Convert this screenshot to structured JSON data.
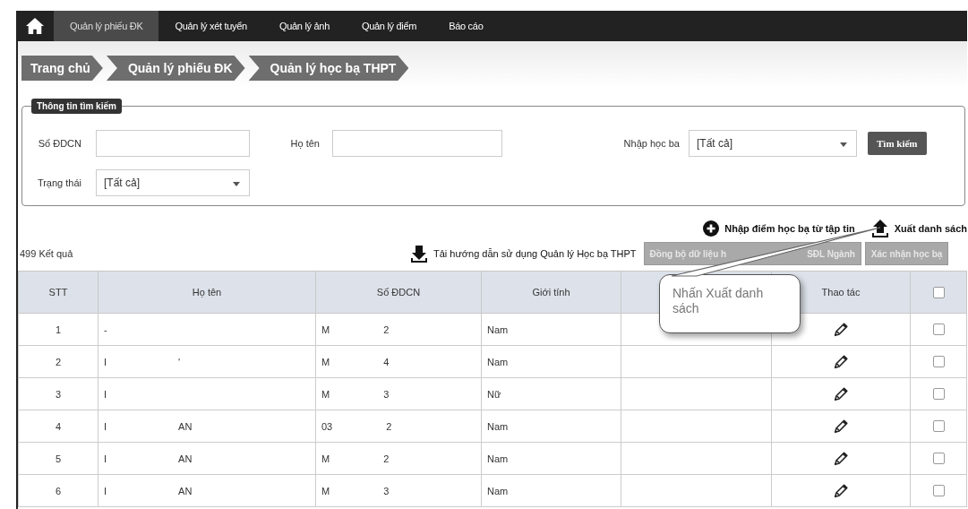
{
  "nav": {
    "tabs": [
      {
        "label": "Quản lý phiếu ĐK",
        "selected": true
      },
      {
        "label": "Quản lý xét tuyển",
        "selected": false
      },
      {
        "label": "Quản lý ảnh",
        "selected": false
      },
      {
        "label": "Quản lý điểm",
        "selected": false
      },
      {
        "label": "Báo cáo",
        "selected": false
      }
    ]
  },
  "breadcrumb": [
    "Trang chủ",
    "Quản lý phiếu ĐK",
    "Quản lý học bạ THPT"
  ],
  "search": {
    "legend": "Thông tin tìm kiếm",
    "fields": [
      {
        "label": "Số ĐDCN",
        "kind": "input"
      },
      {
        "label": "Họ tên",
        "kind": "input"
      },
      {
        "label": "Nhập học ba",
        "kind": "select",
        "value": "[Tất cả]"
      },
      {
        "label": "Trạng thái",
        "kind": "select",
        "value": "[Tất cả]"
      }
    ],
    "button": "Tìm kiếm"
  },
  "actions": {
    "import": "Nhập điểm học bạ từ tập tin",
    "export": "Xuất danh sách",
    "guide": "Tải hướng dẫn sử dụng Quản lý Học bạ THPT",
    "sync_start": "Đồng bộ dữ liệu h",
    "sync_end": "SĐL Ngành",
    "confirm": "Xác nhận học bạ"
  },
  "result_count": "499 Kết quả",
  "callout": "Nhấn Xuất danh sách",
  "table": {
    "columns": [
      "STT",
      "Họ tên",
      "Số ĐDCN",
      "Giới tính",
      "",
      "Thao tác"
    ],
    "header_checked": false,
    "rows": [
      {
        "stt": "1",
        "name_a": "-",
        "name_b": "",
        "id_a": "M",
        "id_b": "2",
        "gender": "Nam",
        "checked": false
      },
      {
        "stt": "2",
        "name_a": "I",
        "name_b": "'",
        "id_a": "M",
        "id_b": "4",
        "gender": "Nam",
        "checked": false
      },
      {
        "stt": "3",
        "name_a": "I",
        "name_b": "",
        "id_a": "M",
        "id_b": "3",
        "gender": "Nữ",
        "checked": false
      },
      {
        "stt": "4",
        "name_a": "I",
        "name_b": "AN",
        "id_a": "03",
        "id_b": "2",
        "gender": "Nam",
        "checked": false
      },
      {
        "stt": "5",
        "name_a": "I",
        "name_b": "AN",
        "id_a": "M",
        "id_b": "2",
        "gender": "Nam",
        "checked": false
      },
      {
        "stt": "6",
        "name_a": "I",
        "name_b": "AN",
        "id_a": "M",
        "id_b": "3",
        "gender": "Nam",
        "checked": false
      }
    ]
  }
}
